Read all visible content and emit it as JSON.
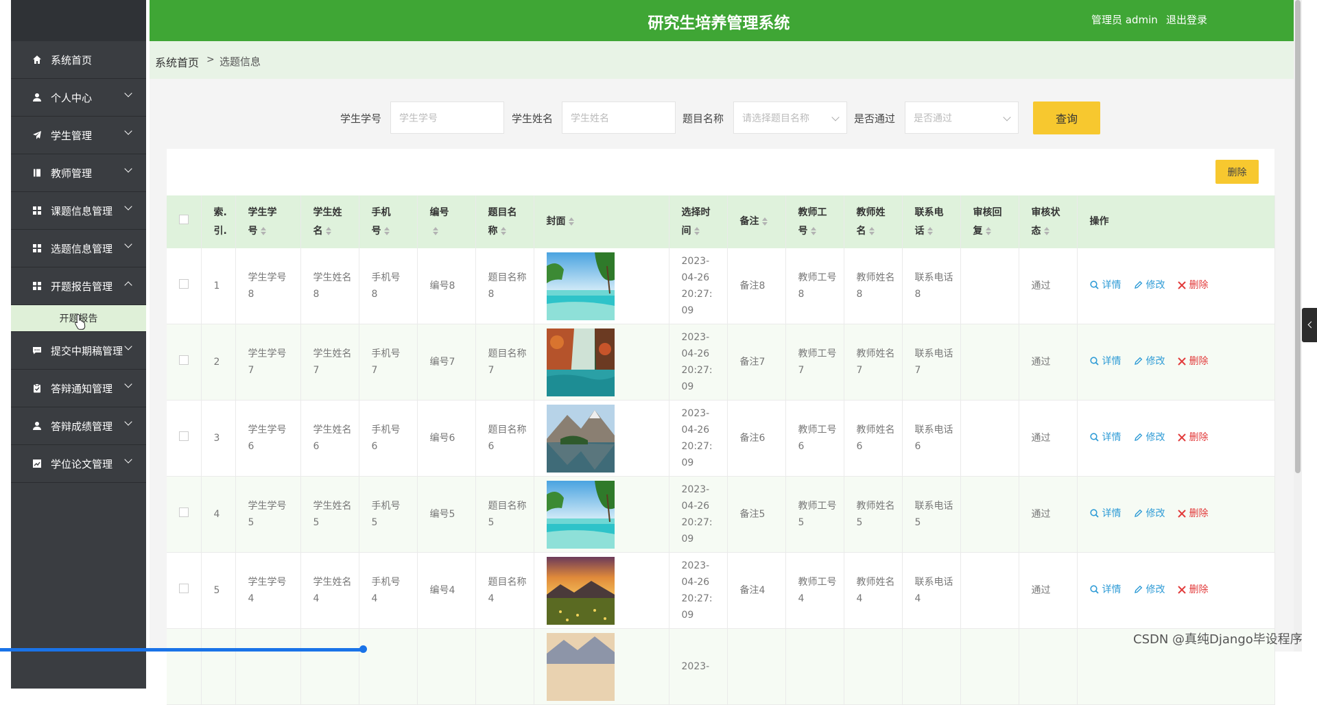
{
  "header": {
    "title": "研究生培养管理系统",
    "user": "管理员 admin",
    "logout": "退出登录"
  },
  "breadcrumb": {
    "home": "系统首页",
    "sep": ">",
    "current": "选题信息"
  },
  "sidebar": {
    "items": [
      {
        "label": "系统首页",
        "icon": "home-icon",
        "arrow": false
      },
      {
        "label": "个人中心",
        "icon": "user-icon",
        "arrow": true
      },
      {
        "label": "学生管理",
        "icon": "send-icon",
        "arrow": true
      },
      {
        "label": "教师管理",
        "icon": "book-icon",
        "arrow": true
      },
      {
        "label": "课题信息管理",
        "icon": "grid-icon",
        "arrow": true
      },
      {
        "label": "选题信息管理",
        "icon": "grid-icon",
        "arrow": true
      },
      {
        "label": "开题报告管理",
        "icon": "grid-icon",
        "arrow": true,
        "expanded": true
      },
      {
        "label": "提交中期稿管理",
        "icon": "chat-icon",
        "arrow": true
      },
      {
        "label": "答辩通知管理",
        "icon": "clipboard-icon",
        "arrow": true
      },
      {
        "label": "答辩成绩管理",
        "icon": "user-icon",
        "arrow": true
      },
      {
        "label": "学位论文管理",
        "icon": "chart-icon",
        "arrow": true
      }
    ],
    "submenu": {
      "label": "开题报告"
    }
  },
  "search": {
    "student_no_label": "学生学号",
    "student_no_placeholder": "学生学号",
    "student_name_label": "学生姓名",
    "student_name_placeholder": "学生姓名",
    "topic_label": "题目名称",
    "topic_placeholder": "请选择题目名称",
    "pass_label": "是否通过",
    "pass_placeholder": "是否通过",
    "query_button": "查询"
  },
  "toolbar": {
    "delete_button": "删除"
  },
  "table": {
    "columns": [
      {
        "label": "",
        "sortable": false
      },
      {
        "label": "索引",
        "sortable": false
      },
      {
        "label": "学生学号",
        "sortable": true
      },
      {
        "label": "学生姓名",
        "sortable": true
      },
      {
        "label": "手机号",
        "sortable": true
      },
      {
        "label": "编号",
        "sortable": true
      },
      {
        "label": "题目名称",
        "sortable": true
      },
      {
        "label": "封面",
        "sortable": true
      },
      {
        "label": "选择时间",
        "sortable": true
      },
      {
        "label": "备注",
        "sortable": true
      },
      {
        "label": "教师工号",
        "sortable": true
      },
      {
        "label": "教师姓名",
        "sortable": true
      },
      {
        "label": "联系电话",
        "sortable": true
      },
      {
        "label": "审核回复",
        "sortable": true
      },
      {
        "label": "审核状态",
        "sortable": true
      },
      {
        "label": "操作",
        "sortable": false
      }
    ],
    "actions": {
      "detail": "详情",
      "edit": "修改",
      "delete": "删除"
    },
    "rows": [
      {
        "index": "1",
        "student_no": "学生学号8",
        "student_name": "学生姓名8",
        "phone": "手机号8",
        "code": "编号8",
        "topic": "题目名称8",
        "cover": "beach",
        "time": "2023-04-26 20:27:09",
        "note": "备注8",
        "teacher_no": "教师工号8",
        "teacher_name": "教师姓名8",
        "tel": "联系电话8",
        "reply": "",
        "status": "通过"
      },
      {
        "index": "2",
        "student_no": "学生学号7",
        "student_name": "学生姓名7",
        "phone": "手机号7",
        "code": "编号7",
        "topic": "题目名称7",
        "cover": "forest-lake",
        "time": "2023-04-26 20:27:09",
        "note": "备注7",
        "teacher_no": "教师工号7",
        "teacher_name": "教师姓名7",
        "tel": "联系电话7",
        "reply": "",
        "status": "通过"
      },
      {
        "index": "3",
        "student_no": "学生学号6",
        "student_name": "学生姓名6",
        "phone": "手机号6",
        "code": "编号6",
        "topic": "题目名称6",
        "cover": "mountain-lake",
        "time": "2023-04-26 20:27:09",
        "note": "备注6",
        "teacher_no": "教师工号6",
        "teacher_name": "教师姓名6",
        "tel": "联系电话6",
        "reply": "",
        "status": "通过"
      },
      {
        "index": "4",
        "student_no": "学生学号5",
        "student_name": "学生姓名5",
        "phone": "手机号5",
        "code": "编号5",
        "topic": "题目名称5",
        "cover": "beach",
        "time": "2023-04-26 20:27:09",
        "note": "备注5",
        "teacher_no": "教师工号5",
        "teacher_name": "教师姓名5",
        "tel": "联系电话5",
        "reply": "",
        "status": "通过"
      },
      {
        "index": "5",
        "student_no": "学生学号4",
        "student_name": "学生姓名4",
        "phone": "手机号4",
        "code": "编号4",
        "topic": "题目名称4",
        "cover": "sunset-meadow",
        "time": "2023-04-26 20:27:09",
        "note": "备注4",
        "teacher_no": "教师工号4",
        "teacher_name": "教师姓名4",
        "tel": "联系电话4",
        "reply": "",
        "status": "通过"
      },
      {
        "index": "",
        "student_no": "",
        "student_name": "",
        "phone": "",
        "code": "",
        "topic": "",
        "cover": "snow-mountain",
        "time": "2023-",
        "note": "",
        "teacher_no": "",
        "teacher_name": "",
        "tel": "",
        "reply": "",
        "status": ""
      }
    ]
  },
  "watermark": "CSDN @真纯Django毕设程序",
  "colors": {
    "header": "#3fa635",
    "sidebar": "#3a3d41",
    "accent_yellow": "#f7c82f",
    "link_blue": "#2e9bd6",
    "danger": "#e23b3b"
  }
}
